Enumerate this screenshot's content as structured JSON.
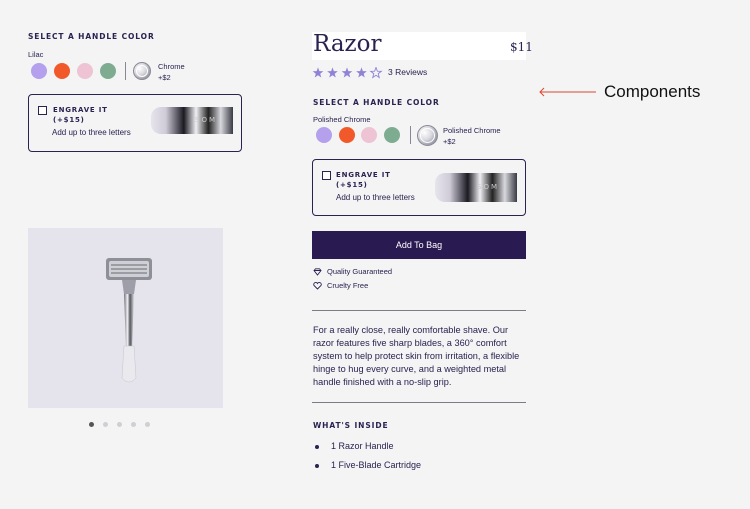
{
  "left": {
    "select_color_label": "SELECT A HANDLE COLOR",
    "selected_color_name": "Lilac",
    "chrome_line1": "Chrome",
    "chrome_line2": "+$2",
    "engrave_title_line1": "ENGRAVE IT",
    "engrave_title_line2": "(+$15)",
    "engrave_sub": "Add up to three letters",
    "engrave_text": "SOM",
    "carousel_pages": 5,
    "carousel_active": 1
  },
  "right": {
    "product_title": "Razor",
    "price": "$11",
    "rating": 4,
    "rating_max": 5,
    "reviews": "3 Reviews",
    "select_color_label": "SELECT A HANDLE COLOR",
    "selected_color_name": "Polished Chrome",
    "chrome_line1": "Polished Chrome",
    "chrome_line2": "+$2",
    "engrave_title_line1": "ENGRAVE IT",
    "engrave_title_line2": "(+$15)",
    "engrave_sub": "Add up to three letters",
    "engrave_text": "SOM",
    "add_to_bag": "Add To Bag",
    "feature_1": "Quality Guaranteed",
    "feature_2": "Cruelty Free",
    "description": "For a really close, really comfortable shave. Our razor features five sharp blades, a 360° comfort system to help protect skin from irritation, a flexible hinge to hug every curve, and a weighted metal handle finished with a no-slip grip.",
    "whats_inside_label": "WHAT'S INSIDE",
    "inside_items": [
      "1 Razor Handle",
      "1 Five-Blade Cartridge"
    ]
  },
  "annotation": {
    "label": "Components"
  },
  "colors": {
    "swatches": [
      "#b4a0ec",
      "#f2592a",
      "#eec3d3",
      "#7eac91"
    ],
    "primary": "#2a1a52",
    "star": "#8f83d6",
    "annotation_arrow": "#d9482f"
  },
  "icons": {
    "star": "star-icon",
    "diamond": "diamond-icon",
    "heart": "heart-icon"
  }
}
